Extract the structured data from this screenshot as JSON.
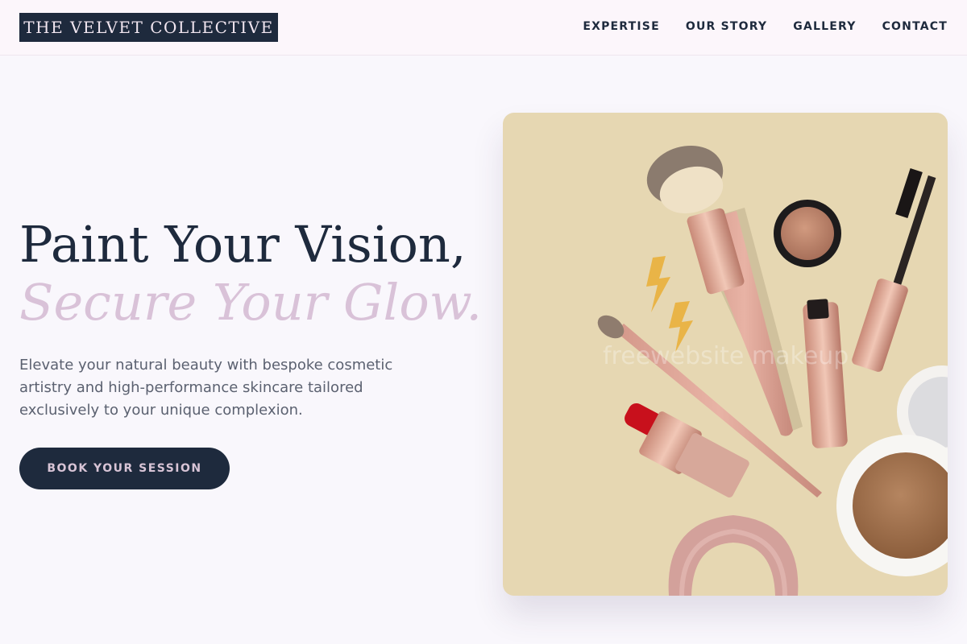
{
  "brand": {
    "name": "THE VELVET COLLECTIVE"
  },
  "nav": {
    "items": [
      {
        "label": "EXPERTISE"
      },
      {
        "label": "OUR STORY"
      },
      {
        "label": "GALLERY"
      },
      {
        "label": "CONTACT"
      }
    ]
  },
  "hero": {
    "title_line1": "Paint Your Vision,",
    "title_line2": "Secure Your Glow.",
    "description": "Elevate your natural beauty with bespoke cosmetic artistry and high-performance skincare tailored exclusively to your unique complexion.",
    "cta_label": "BOOK YOUR SESSION"
  },
  "image": {
    "watermark": "freewebsite makeup"
  },
  "colors": {
    "navy": "#1e2a3d",
    "lilac": "#d9c2d8",
    "page_background": "#f9f7fc",
    "photo_background": "#e6d7b2",
    "rose_gold": "#d9a08f"
  }
}
